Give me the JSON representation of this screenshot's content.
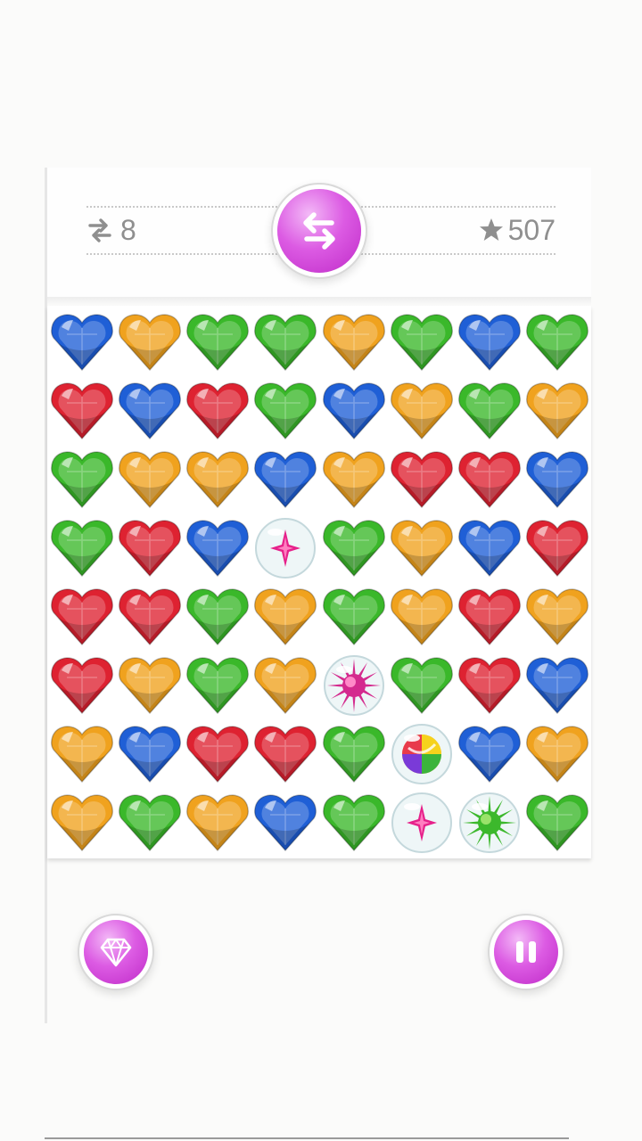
{
  "hud": {
    "moves_value": "8",
    "score_value": "507",
    "moves_icon": "swap-arrows-icon",
    "score_icon": "star-icon",
    "shuffle_icon": "shuffle-arrows-icon"
  },
  "controls": {
    "gem_icon": "diamond-icon",
    "pause_icon": "pause-icon",
    "accent": "#d64fde"
  },
  "board": {
    "columns": 8,
    "rows": 8,
    "grid": [
      [
        "blue",
        "orange",
        "green",
        "green",
        "orange",
        "green",
        "blue",
        "green"
      ],
      [
        "red",
        "blue",
        "red",
        "green",
        "blue",
        "orange",
        "green",
        "orange"
      ],
      [
        "green",
        "orange",
        "orange",
        "blue",
        "orange",
        "red",
        "red",
        "blue"
      ],
      [
        "green",
        "red",
        "blue",
        "bubble-star",
        "green",
        "orange",
        "blue",
        "red"
      ],
      [
        "red",
        "red",
        "green",
        "orange",
        "green",
        "orange",
        "red",
        "orange"
      ],
      [
        "red",
        "orange",
        "green",
        "orange",
        "bubble-burst-pink",
        "green",
        "red",
        "blue"
      ],
      [
        "orange",
        "blue",
        "red",
        "red",
        "green",
        "bubble-rainbow",
        "blue",
        "orange"
      ],
      [
        "orange",
        "green",
        "orange",
        "blue",
        "green",
        "bubble-star",
        "bubble-burst-green",
        "green"
      ]
    ],
    "colors": {
      "blue": "#1f5fd6",
      "orange": "#f0a21e",
      "green": "#3ab82a",
      "red": "#de2231"
    }
  }
}
